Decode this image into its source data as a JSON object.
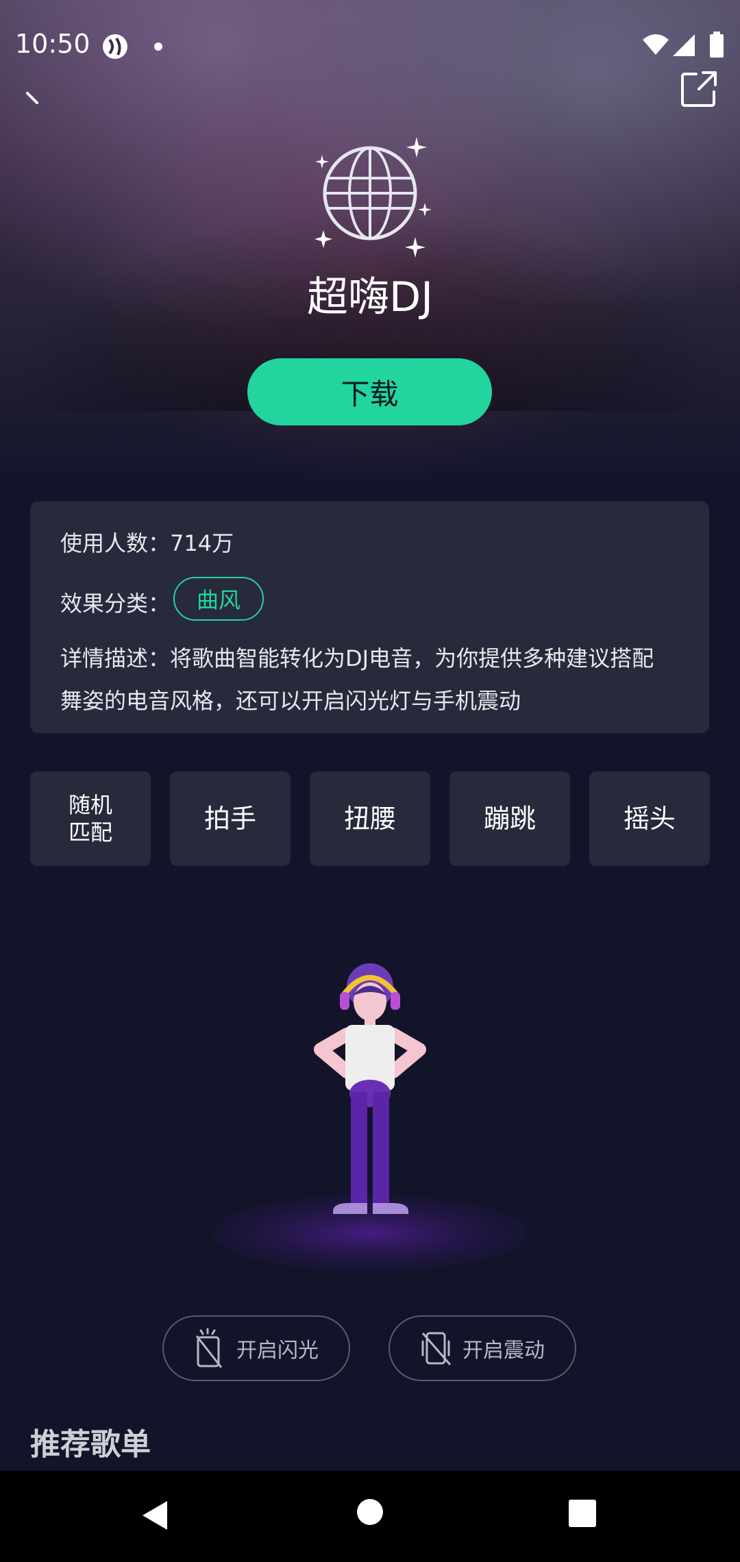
{
  "status_bar": {
    "time": "10:50"
  },
  "header": {
    "title": "超嗨DJ"
  },
  "actions": {
    "download_label": "下载"
  },
  "info": {
    "users_label": "使用人数：714万",
    "category_label": "效果分类：",
    "category_tag": "曲风",
    "description_line1": "详情描述：将歌曲智能转化为DJ电音，为你提供多种建议搭配",
    "description_line2": "舞姿的电音风格，还可以开启闪光灯与手机震动"
  },
  "dance_moves": [
    {
      "label_line1": "随机",
      "label_line2": "匹配"
    },
    {
      "label": "拍手"
    },
    {
      "label": "扭腰"
    },
    {
      "label": "蹦跳"
    },
    {
      "label": "摇头"
    }
  ],
  "toggles": {
    "flash_label": "开启闪光",
    "vibrate_label": "开启震动"
  },
  "sections": {
    "recommended_title": "推荐歌单"
  },
  "colors": {
    "accent": "#22d59e",
    "background": "#12142a",
    "card": "#272a3b",
    "dancer_purple": "#6a2fb6"
  }
}
